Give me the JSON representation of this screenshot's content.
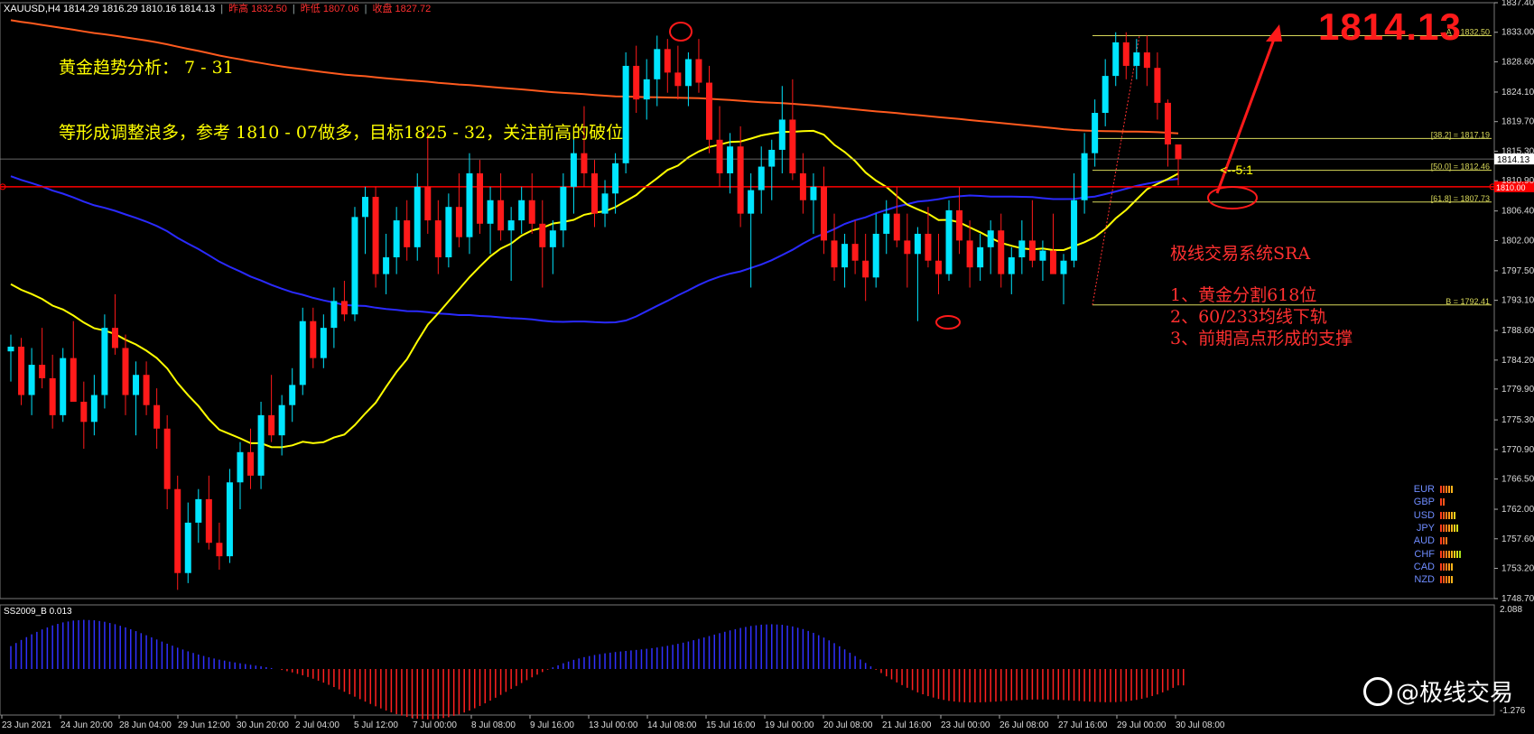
{
  "header": {
    "symbol": "XAUUSD,H4  1814.29 1816.29 1810.16 1814.13",
    "prev_high": "昨高 1832.50",
    "prev_low": "昨低 1807.06",
    "prev_close": "收盘 1827.72"
  },
  "big_price": "1814.13",
  "annotations": {
    "title": "黄金趋势分析：  7 - 31",
    "plan": "等形成调整浪多，参考 1810 - 07做多，目标1825 - 32，关注前高的破位",
    "system": "极线交易系统SRA",
    "point1": "1、黄金分割618位",
    "point2": "2、60/233均线下轨",
    "point3": "3、前期高点形成的支撑",
    "ratio": "<--5:1"
  },
  "oscillator": {
    "label": "SS2009_B 0.013",
    "top_value": "2.088",
    "bottom_value": "-1.276"
  },
  "watermark": "@极线交易",
  "currencies": [
    {
      "name": "EUR",
      "level": 5
    },
    {
      "name": "GBP",
      "level": 2
    },
    {
      "name": "USD",
      "level": 6
    },
    {
      "name": "JPY",
      "level": 7
    },
    {
      "name": "AUD",
      "level": 3
    },
    {
      "name": "CHF",
      "level": 8
    },
    {
      "name": "CAD",
      "level": 5
    },
    {
      "name": "NZD",
      "level": 5
    }
  ],
  "colors": {
    "bull": "#00e5ff",
    "bear": "#ff1a1a",
    "ma_fast": "#ffff00",
    "ma_mid": "#2a2aff",
    "ma_slow": "#ff5a1e",
    "level_line": "#ff0000",
    "fib": "#d8d85a"
  },
  "chart_data": {
    "type": "candlestick",
    "symbol": "XAUUSD",
    "timeframe": "H4",
    "ylim": [
      1748.7,
      1837.4
    ],
    "y_ticks": [
      "1837.40",
      "1833.00",
      "1828.60",
      "1824.10",
      "1819.70",
      "1815.30",
      "1810.90",
      "1806.40",
      "1802.00",
      "1797.50",
      "1793.10",
      "1788.60",
      "1784.20",
      "1779.90",
      "1775.30",
      "1770.90",
      "1766.50",
      "1762.00",
      "1757.60",
      "1753.20",
      "1748.70"
    ],
    "x_ticks": [
      "23 Jun 2021",
      "24 Jun 20:00",
      "28 Jun 04:00",
      "29 Jun 12:00",
      "30 Jun 20:00",
      "2 Jul 04:00",
      "5 Jul 12:00",
      "7 Jul 00:00",
      "8 Jul 08:00",
      "9 Jul 16:00",
      "13 Jul 00:00",
      "14 Jul 08:00",
      "15 Jul 16:00",
      "19 Jul 00:00",
      "20 Jul 08:00",
      "21 Jul 16:00",
      "23 Jul 00:00",
      "26 Jul 08:00",
      "27 Jul 16:00",
      "29 Jul 00:00",
      "30 Jul 08:00"
    ],
    "current_price": 1814.13,
    "current_price_label": "1814.13",
    "red_level": 1810.0,
    "red_level_label": "1810.00",
    "fibonacci": [
      {
        "label": "A = 1832.50",
        "price": 1832.5
      },
      {
        "label": "[38.2] = 1817.19",
        "price": 1817.19
      },
      {
        "label": "[50.0] = 1812.46",
        "price": 1812.46
      },
      {
        "label": "[61.8] = 1807.73",
        "price": 1807.73
      },
      {
        "label": "B = 1792.41",
        "price": 1792.41
      }
    ],
    "candles": [
      [
        1785.5,
        1788.0,
        1781.0,
        1786.2
      ],
      [
        1786.2,
        1787.5,
        1777.5,
        1779.0
      ],
      [
        1779.0,
        1786.0,
        1776.0,
        1783.5
      ],
      [
        1783.5,
        1789.0,
        1780.0,
        1781.5
      ],
      [
        1781.5,
        1785.0,
        1774.0,
        1776.0
      ],
      [
        1776.0,
        1786.0,
        1775.0,
        1784.5
      ],
      [
        1784.5,
        1790.0,
        1782.0,
        1778.0
      ],
      [
        1778.0,
        1781.0,
        1771.0,
        1775.0
      ],
      [
        1775.0,
        1782.0,
        1773.0,
        1779.0
      ],
      [
        1779.0,
        1791.0,
        1777.0,
        1789.0
      ],
      [
        1789.0,
        1794.0,
        1785.0,
        1786.0
      ],
      [
        1786.0,
        1788.0,
        1776.0,
        1779.0
      ],
      [
        1779.0,
        1784.0,
        1773.0,
        1782.0
      ],
      [
        1782.0,
        1784.0,
        1776.0,
        1777.5
      ],
      [
        1777.5,
        1780.0,
        1771.0,
        1774.0
      ],
      [
        1774.0,
        1776.0,
        1762.0,
        1765.0
      ],
      [
        1765.0,
        1767.0,
        1750.0,
        1752.5
      ],
      [
        1752.5,
        1763.0,
        1751.0,
        1760.0
      ],
      [
        1760.0,
        1765.0,
        1757.0,
        1763.5
      ],
      [
        1763.5,
        1767.0,
        1756.0,
        1757.0
      ],
      [
        1757.0,
        1760.0,
        1753.0,
        1755.0
      ],
      [
        1755.0,
        1768.0,
        1754.0,
        1766.0
      ],
      [
        1766.0,
        1772.0,
        1762.0,
        1770.5
      ],
      [
        1770.5,
        1774.0,
        1765.0,
        1767.0
      ],
      [
        1767.0,
        1778.0,
        1765.0,
        1776.0
      ],
      [
        1776.0,
        1782.0,
        1772.0,
        1773.0
      ],
      [
        1773.0,
        1779.0,
        1770.0,
        1777.5
      ],
      [
        1777.5,
        1783.0,
        1775.0,
        1780.5
      ],
      [
        1780.5,
        1792.0,
        1779.0,
        1790.0
      ],
      [
        1790.0,
        1792.0,
        1783.0,
        1784.5
      ],
      [
        1784.5,
        1791.0,
        1783.0,
        1789.0
      ],
      [
        1789.0,
        1795.0,
        1786.0,
        1793.0
      ],
      [
        1793.0,
        1796.0,
        1790.0,
        1791.0
      ],
      [
        1791.0,
        1807.0,
        1790.0,
        1805.5
      ],
      [
        1805.5,
        1810.0,
        1800.0,
        1808.5
      ],
      [
        1808.5,
        1810.0,
        1795.0,
        1797.0
      ],
      [
        1797.0,
        1803.0,
        1794.0,
        1799.5
      ],
      [
        1799.5,
        1807.0,
        1797.0,
        1805.0
      ],
      [
        1805.0,
        1808.0,
        1799.0,
        1801.0
      ],
      [
        1801.0,
        1812.0,
        1799.0,
        1810.0
      ],
      [
        1810.0,
        1818.0,
        1803.0,
        1805.0
      ],
      [
        1805.0,
        1808.0,
        1797.0,
        1799.5
      ],
      [
        1799.5,
        1809.0,
        1798.0,
        1807.0
      ],
      [
        1807.0,
        1812.0,
        1801.0,
        1802.5
      ],
      [
        1802.5,
        1815.0,
        1800.0,
        1812.0
      ],
      [
        1812.0,
        1814.0,
        1803.0,
        1804.5
      ],
      [
        1804.5,
        1810.0,
        1800.0,
        1808.0
      ],
      [
        1808.0,
        1812.0,
        1802.0,
        1803.5
      ],
      [
        1803.5,
        1807.0,
        1796.0,
        1805.0
      ],
      [
        1805.0,
        1810.0,
        1803.0,
        1808.0
      ],
      [
        1808.0,
        1812.0,
        1803.0,
        1804.5
      ],
      [
        1804.5,
        1808.0,
        1795.0,
        1801.0
      ],
      [
        1801.0,
        1805.0,
        1797.0,
        1803.5
      ],
      [
        1803.5,
        1812.0,
        1801.0,
        1810.0
      ],
      [
        1810.0,
        1818.0,
        1806.0,
        1815.0
      ],
      [
        1815.0,
        1822.0,
        1810.0,
        1812.0
      ],
      [
        1812.0,
        1814.0,
        1804.0,
        1806.0
      ],
      [
        1806.0,
        1811.0,
        1804.0,
        1809.0
      ],
      [
        1809.0,
        1815.0,
        1806.0,
        1813.5
      ],
      [
        1813.5,
        1830.0,
        1812.0,
        1828.0
      ],
      [
        1828.0,
        1831.0,
        1821.0,
        1823.0
      ],
      [
        1823.0,
        1829.0,
        1820.0,
        1826.0
      ],
      [
        1826.0,
        1832.5,
        1822.0,
        1830.5
      ],
      [
        1830.5,
        1832.0,
        1824.0,
        1827.0
      ],
      [
        1827.0,
        1831.0,
        1823.0,
        1825.0
      ],
      [
        1825.0,
        1830.0,
        1822.0,
        1829.0
      ],
      [
        1829.0,
        1832.0,
        1824.0,
        1825.5
      ],
      [
        1825.5,
        1828.0,
        1815.0,
        1817.0
      ],
      [
        1817.0,
        1822.0,
        1810.0,
        1812.0
      ],
      [
        1812.0,
        1818.0,
        1809.0,
        1816.0
      ],
      [
        1816.0,
        1819.0,
        1804.0,
        1806.0
      ],
      [
        1806.0,
        1812.0,
        1795.0,
        1809.5
      ],
      [
        1809.5,
        1816.0,
        1806.0,
        1813.0
      ],
      [
        1813.0,
        1817.0,
        1808.0,
        1815.5
      ],
      [
        1815.5,
        1825.0,
        1812.0,
        1820.0
      ],
      [
        1820.0,
        1826.0,
        1811.0,
        1812.0
      ],
      [
        1812.0,
        1815.0,
        1806.0,
        1808.0
      ],
      [
        1808.0,
        1812.0,
        1803.0,
        1810.0
      ],
      [
        1810.0,
        1813.0,
        1800.0,
        1802.0
      ],
      [
        1802.0,
        1806.0,
        1796.0,
        1798.0
      ],
      [
        1798.0,
        1803.0,
        1795.0,
        1801.5
      ],
      [
        1801.5,
        1805.0,
        1797.0,
        1799.0
      ],
      [
        1799.0,
        1803.0,
        1793.0,
        1796.5
      ],
      [
        1796.5,
        1806.0,
        1795.0,
        1803.0
      ],
      [
        1803.0,
        1808.0,
        1800.0,
        1806.0
      ],
      [
        1806.0,
        1810.0,
        1801.0,
        1802.0
      ],
      [
        1802.0,
        1806.0,
        1795.0,
        1800.0
      ],
      [
        1800.0,
        1804.0,
        1790.0,
        1803.0
      ],
      [
        1803.0,
        1807.0,
        1798.0,
        1799.0
      ],
      [
        1799.0,
        1803.0,
        1794.0,
        1797.0
      ],
      [
        1797.0,
        1808.0,
        1796.0,
        1806.5
      ],
      [
        1806.5,
        1810.0,
        1800.0,
        1802.0
      ],
      [
        1802.0,
        1805.0,
        1795.0,
        1798.0
      ],
      [
        1798.0,
        1803.0,
        1796.0,
        1801.0
      ],
      [
        1801.0,
        1805.0,
        1797.0,
        1803.5
      ],
      [
        1803.5,
        1806.0,
        1795.0,
        1797.0
      ],
      [
        1797.0,
        1801.0,
        1794.0,
        1799.5
      ],
      [
        1799.5,
        1805.0,
        1797.0,
        1802.0
      ],
      [
        1802.0,
        1808.0,
        1798.0,
        1799.0
      ],
      [
        1799.0,
        1802.0,
        1796.0,
        1800.5
      ],
      [
        1800.5,
        1806.0,
        1798.0,
        1797.0
      ],
      [
        1797.0,
        1800.0,
        1792.5,
        1799.0
      ],
      [
        1799.0,
        1812.0,
        1798.0,
        1808.0
      ],
      [
        1808.0,
        1818.0,
        1806.0,
        1815.0
      ],
      [
        1815.0,
        1823.0,
        1813.0,
        1821.0
      ],
      [
        1821.0,
        1829.0,
        1819.0,
        1826.5
      ],
      [
        1826.5,
        1833.0,
        1825.0,
        1831.5
      ],
      [
        1831.5,
        1833.0,
        1826.0,
        1828.0
      ],
      [
        1828.0,
        1832.0,
        1826.0,
        1830.0
      ],
      [
        1830.0,
        1832.5,
        1825.0,
        1827.7
      ],
      [
        1827.7,
        1830.0,
        1820.0,
        1822.5
      ],
      [
        1822.5,
        1823.0,
        1813.0,
        1816.3
      ],
      [
        1816.3,
        1816.3,
        1810.2,
        1814.1
      ]
    ]
  }
}
